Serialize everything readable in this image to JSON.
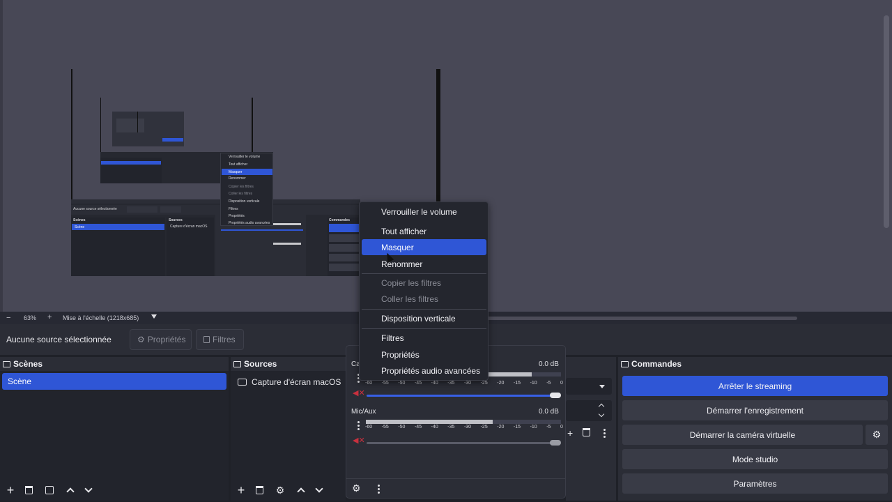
{
  "zoom": {
    "minus": "−",
    "level": "63%",
    "plus": "+",
    "scale_mode": "Mise à l'échelle (1218x685)",
    "dropdown_icon": "caret-down-icon"
  },
  "source_toolbar": {
    "no_selection": "Aucune source sélectionnée",
    "properties": "Propriétés",
    "filters": "Filtres"
  },
  "scenes": {
    "title": "Scènes",
    "items": [
      "Scène"
    ],
    "footer_icons": [
      "plus-icon",
      "trash-icon",
      "filter-icon",
      "arrow-up-icon",
      "arrow-down-icon"
    ]
  },
  "sources": {
    "title": "Sources",
    "items": [
      "Capture d'écran macOS"
    ],
    "footer_icons": [
      "plus-icon",
      "trash-icon",
      "gear-icon",
      "arrow-up-icon",
      "arrow-down-icon"
    ]
  },
  "mixer": {
    "channels": [
      {
        "name": "Ca",
        "db": "0.0 dB",
        "level": 0.0,
        "volume": 1.0,
        "muted": true
      },
      {
        "name": "Mic/Aux",
        "db": "0.0 dB",
        "level": 0.0,
        "volume": 1.0,
        "muted": true
      }
    ],
    "scale": [
      "-60",
      "-55",
      "-50",
      "-45",
      "-40",
      "-35",
      "-30",
      "-25",
      "-20",
      "-15",
      "-10",
      "-5",
      "0"
    ]
  },
  "controls": {
    "title": "Commandes",
    "buttons": [
      "Arrêter le streaming",
      "Démarrer l'enregistrement",
      "Démarrer la caméra virtuelle",
      "Mode studio",
      "Paramètres"
    ]
  },
  "context_menu": {
    "items": [
      {
        "label": "Verrouiller le volume",
        "state": "normal"
      },
      {
        "label": "Tout afficher",
        "state": "normal"
      },
      {
        "label": "Masquer",
        "state": "active"
      },
      {
        "label": "Renommer",
        "state": "normal"
      },
      {
        "label": "Copier les filtres",
        "state": "disabled"
      },
      {
        "label": "Coller les filtres",
        "state": "disabled"
      },
      {
        "label": "Disposition verticale",
        "state": "normal"
      },
      {
        "label": "Filtres",
        "state": "normal"
      },
      {
        "label": "Propriétés",
        "state": "normal"
      },
      {
        "label": "Propriétés audio avancées",
        "state": "normal"
      }
    ]
  },
  "colors": {
    "accent": "#2f56d6",
    "muted_red": "#c8303e",
    "panel": "#2b2d36",
    "preview_bg": "#484856"
  }
}
